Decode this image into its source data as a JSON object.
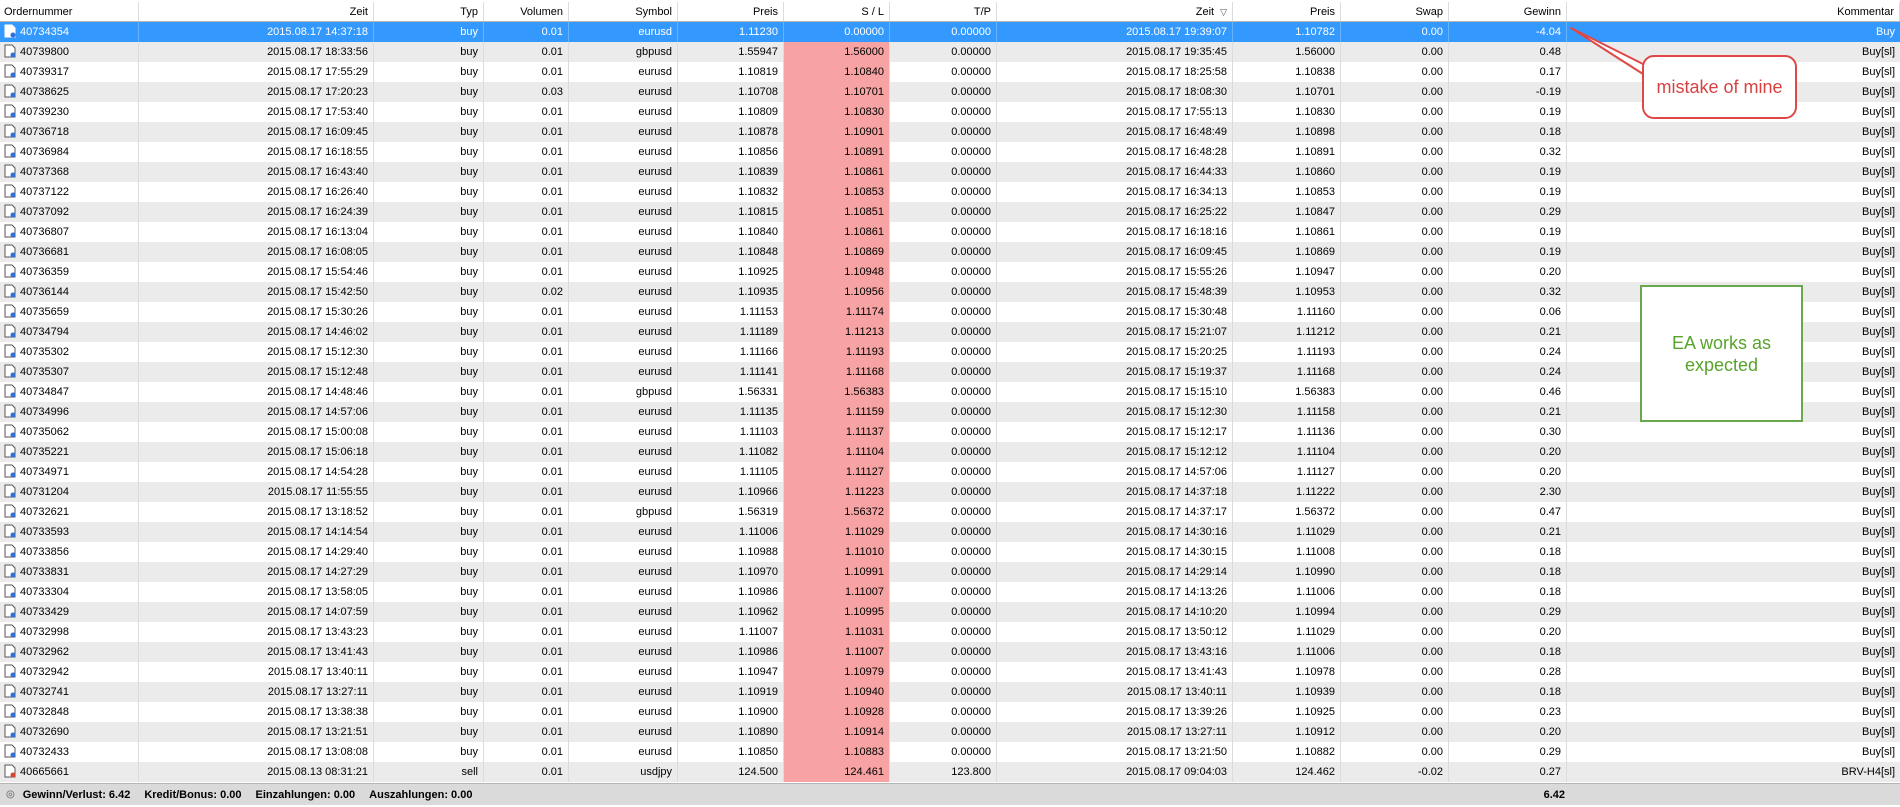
{
  "columns": {
    "order": "Ordernummer",
    "time": "Zeit",
    "type": "Typ",
    "volume": "Volumen",
    "symbol": "Symbol",
    "price": "Preis",
    "sl": "S / L",
    "tp": "T/P",
    "close_time": "Zeit",
    "close_price": "Preis",
    "swap": "Swap",
    "profit": "Gewinn",
    "comment": "Kommentar"
  },
  "rows": [
    {
      "order": "40734354",
      "time": "2015.08.17 14:37:18",
      "type": "buy",
      "volume": "0.01",
      "symbol": "eurusd",
      "price": "1.11230",
      "sl": "0.00000",
      "tp": "0.00000",
      "close_time": "2015.08.17 19:39:07",
      "close_price": "1.10782",
      "swap": "0.00",
      "profit": "-4.04",
      "comment": "Buy"
    },
    {
      "order": "40739800",
      "time": "2015.08.17 18:33:56",
      "type": "buy",
      "volume": "0.01",
      "symbol": "gbpusd",
      "price": "1.55947",
      "sl": "1.56000",
      "tp": "0.00000",
      "close_time": "2015.08.17 19:35:45",
      "close_price": "1.56000",
      "swap": "0.00",
      "profit": "0.48",
      "comment": "Buy[sl]"
    },
    {
      "order": "40739317",
      "time": "2015.08.17 17:55:29",
      "type": "buy",
      "volume": "0.01",
      "symbol": "eurusd",
      "price": "1.10819",
      "sl": "1.10840",
      "tp": "0.00000",
      "close_time": "2015.08.17 18:25:58",
      "close_price": "1.10838",
      "swap": "0.00",
      "profit": "0.17",
      "comment": "Buy[sl]"
    },
    {
      "order": "40738625",
      "time": "2015.08.17 17:20:23",
      "type": "buy",
      "volume": "0.03",
      "symbol": "eurusd",
      "price": "1.10708",
      "sl": "1.10701",
      "tp": "0.00000",
      "close_time": "2015.08.17 18:08:30",
      "close_price": "1.10701",
      "swap": "0.00",
      "profit": "-0.19",
      "comment": "Buy[sl]"
    },
    {
      "order": "40739230",
      "time": "2015.08.17 17:53:40",
      "type": "buy",
      "volume": "0.01",
      "symbol": "eurusd",
      "price": "1.10809",
      "sl": "1.10830",
      "tp": "0.00000",
      "close_time": "2015.08.17 17:55:13",
      "close_price": "1.10830",
      "swap": "0.00",
      "profit": "0.19",
      "comment": "Buy[sl]"
    },
    {
      "order": "40736718",
      "time": "2015.08.17 16:09:45",
      "type": "buy",
      "volume": "0.01",
      "symbol": "eurusd",
      "price": "1.10878",
      "sl": "1.10901",
      "tp": "0.00000",
      "close_time": "2015.08.17 16:48:49",
      "close_price": "1.10898",
      "swap": "0.00",
      "profit": "0.18",
      "comment": "Buy[sl]"
    },
    {
      "order": "40736984",
      "time": "2015.08.17 16:18:55",
      "type": "buy",
      "volume": "0.01",
      "symbol": "eurusd",
      "price": "1.10856",
      "sl": "1.10891",
      "tp": "0.00000",
      "close_time": "2015.08.17 16:48:28",
      "close_price": "1.10891",
      "swap": "0.00",
      "profit": "0.32",
      "comment": "Buy[sl]"
    },
    {
      "order": "40737368",
      "time": "2015.08.17 16:43:40",
      "type": "buy",
      "volume": "0.01",
      "symbol": "eurusd",
      "price": "1.10839",
      "sl": "1.10861",
      "tp": "0.00000",
      "close_time": "2015.08.17 16:44:33",
      "close_price": "1.10860",
      "swap": "0.00",
      "profit": "0.19",
      "comment": "Buy[sl]"
    },
    {
      "order": "40737122",
      "time": "2015.08.17 16:26:40",
      "type": "buy",
      "volume": "0.01",
      "symbol": "eurusd",
      "price": "1.10832",
      "sl": "1.10853",
      "tp": "0.00000",
      "close_time": "2015.08.17 16:34:13",
      "close_price": "1.10853",
      "swap": "0.00",
      "profit": "0.19",
      "comment": "Buy[sl]"
    },
    {
      "order": "40737092",
      "time": "2015.08.17 16:24:39",
      "type": "buy",
      "volume": "0.01",
      "symbol": "eurusd",
      "price": "1.10815",
      "sl": "1.10851",
      "tp": "0.00000",
      "close_time": "2015.08.17 16:25:22",
      "close_price": "1.10847",
      "swap": "0.00",
      "profit": "0.29",
      "comment": "Buy[sl]"
    },
    {
      "order": "40736807",
      "time": "2015.08.17 16:13:04",
      "type": "buy",
      "volume": "0.01",
      "symbol": "eurusd",
      "price": "1.10840",
      "sl": "1.10861",
      "tp": "0.00000",
      "close_time": "2015.08.17 16:18:16",
      "close_price": "1.10861",
      "swap": "0.00",
      "profit": "0.19",
      "comment": "Buy[sl]"
    },
    {
      "order": "40736681",
      "time": "2015.08.17 16:08:05",
      "type": "buy",
      "volume": "0.01",
      "symbol": "eurusd",
      "price": "1.10848",
      "sl": "1.10869",
      "tp": "0.00000",
      "close_time": "2015.08.17 16:09:45",
      "close_price": "1.10869",
      "swap": "0.00",
      "profit": "0.19",
      "comment": "Buy[sl]"
    },
    {
      "order": "40736359",
      "time": "2015.08.17 15:54:46",
      "type": "buy",
      "volume": "0.01",
      "symbol": "eurusd",
      "price": "1.10925",
      "sl": "1.10948",
      "tp": "0.00000",
      "close_time": "2015.08.17 15:55:26",
      "close_price": "1.10947",
      "swap": "0.00",
      "profit": "0.20",
      "comment": "Buy[sl]"
    },
    {
      "order": "40736144",
      "time": "2015.08.17 15:42:50",
      "type": "buy",
      "volume": "0.02",
      "symbol": "eurusd",
      "price": "1.10935",
      "sl": "1.10956",
      "tp": "0.00000",
      "close_time": "2015.08.17 15:48:39",
      "close_price": "1.10953",
      "swap": "0.00",
      "profit": "0.32",
      "comment": "Buy[sl]"
    },
    {
      "order": "40735659",
      "time": "2015.08.17 15:30:26",
      "type": "buy",
      "volume": "0.01",
      "symbol": "eurusd",
      "price": "1.11153",
      "sl": "1.11174",
      "tp": "0.00000",
      "close_time": "2015.08.17 15:30:48",
      "close_price": "1.11160",
      "swap": "0.00",
      "profit": "0.06",
      "comment": "Buy[sl]"
    },
    {
      "order": "40734794",
      "time": "2015.08.17 14:46:02",
      "type": "buy",
      "volume": "0.01",
      "symbol": "eurusd",
      "price": "1.11189",
      "sl": "1.11213",
      "tp": "0.00000",
      "close_time": "2015.08.17 15:21:07",
      "close_price": "1.11212",
      "swap": "0.00",
      "profit": "0.21",
      "comment": "Buy[sl]"
    },
    {
      "order": "40735302",
      "time": "2015.08.17 15:12:30",
      "type": "buy",
      "volume": "0.01",
      "symbol": "eurusd",
      "price": "1.11166",
      "sl": "1.11193",
      "tp": "0.00000",
      "close_time": "2015.08.17 15:20:25",
      "close_price": "1.11193",
      "swap": "0.00",
      "profit": "0.24",
      "comment": "Buy[sl]"
    },
    {
      "order": "40735307",
      "time": "2015.08.17 15:12:48",
      "type": "buy",
      "volume": "0.01",
      "symbol": "eurusd",
      "price": "1.11141",
      "sl": "1.11168",
      "tp": "0.00000",
      "close_time": "2015.08.17 15:19:37",
      "close_price": "1.11168",
      "swap": "0.00",
      "profit": "0.24",
      "comment": "Buy[sl]"
    },
    {
      "order": "40734847",
      "time": "2015.08.17 14:48:46",
      "type": "buy",
      "volume": "0.01",
      "symbol": "gbpusd",
      "price": "1.56331",
      "sl": "1.56383",
      "tp": "0.00000",
      "close_time": "2015.08.17 15:15:10",
      "close_price": "1.56383",
      "swap": "0.00",
      "profit": "0.46",
      "comment": "Buy[sl]"
    },
    {
      "order": "40734996",
      "time": "2015.08.17 14:57:06",
      "type": "buy",
      "volume": "0.01",
      "symbol": "eurusd",
      "price": "1.11135",
      "sl": "1.11159",
      "tp": "0.00000",
      "close_time": "2015.08.17 15:12:30",
      "close_price": "1.11158",
      "swap": "0.00",
      "profit": "0.21",
      "comment": "Buy[sl]"
    },
    {
      "order": "40735062",
      "time": "2015.08.17 15:00:08",
      "type": "buy",
      "volume": "0.01",
      "symbol": "eurusd",
      "price": "1.11103",
      "sl": "1.11137",
      "tp": "0.00000",
      "close_time": "2015.08.17 15:12:17",
      "close_price": "1.11136",
      "swap": "0.00",
      "profit": "0.30",
      "comment": "Buy[sl]"
    },
    {
      "order": "40735221",
      "time": "2015.08.17 15:06:18",
      "type": "buy",
      "volume": "0.01",
      "symbol": "eurusd",
      "price": "1.11082",
      "sl": "1.11104",
      "tp": "0.00000",
      "close_time": "2015.08.17 15:12:12",
      "close_price": "1.11104",
      "swap": "0.00",
      "profit": "0.20",
      "comment": "Buy[sl]"
    },
    {
      "order": "40734971",
      "time": "2015.08.17 14:54:28",
      "type": "buy",
      "volume": "0.01",
      "symbol": "eurusd",
      "price": "1.11105",
      "sl": "1.11127",
      "tp": "0.00000",
      "close_time": "2015.08.17 14:57:06",
      "close_price": "1.11127",
      "swap": "0.00",
      "profit": "0.20",
      "comment": "Buy[sl]"
    },
    {
      "order": "40731204",
      "time": "2015.08.17 11:55:55",
      "type": "buy",
      "volume": "0.01",
      "symbol": "eurusd",
      "price": "1.10966",
      "sl": "1.11223",
      "tp": "0.00000",
      "close_time": "2015.08.17 14:37:18",
      "close_price": "1.11222",
      "swap": "0.00",
      "profit": "2.30",
      "comment": "Buy[sl]"
    },
    {
      "order": "40732621",
      "time": "2015.08.17 13:18:52",
      "type": "buy",
      "volume": "0.01",
      "symbol": "gbpusd",
      "price": "1.56319",
      "sl": "1.56372",
      "tp": "0.00000",
      "close_time": "2015.08.17 14:37:17",
      "close_price": "1.56372",
      "swap": "0.00",
      "profit": "0.47",
      "comment": "Buy[sl]"
    },
    {
      "order": "40733593",
      "time": "2015.08.17 14:14:54",
      "type": "buy",
      "volume": "0.01",
      "symbol": "eurusd",
      "price": "1.11006",
      "sl": "1.11029",
      "tp": "0.00000",
      "close_time": "2015.08.17 14:30:16",
      "close_price": "1.11029",
      "swap": "0.00",
      "profit": "0.21",
      "comment": "Buy[sl]"
    },
    {
      "order": "40733856",
      "time": "2015.08.17 14:29:40",
      "type": "buy",
      "volume": "0.01",
      "symbol": "eurusd",
      "price": "1.10988",
      "sl": "1.11010",
      "tp": "0.00000",
      "close_time": "2015.08.17 14:30:15",
      "close_price": "1.11008",
      "swap": "0.00",
      "profit": "0.18",
      "comment": "Buy[sl]"
    },
    {
      "order": "40733831",
      "time": "2015.08.17 14:27:29",
      "type": "buy",
      "volume": "0.01",
      "symbol": "eurusd",
      "price": "1.10970",
      "sl": "1.10991",
      "tp": "0.00000",
      "close_time": "2015.08.17 14:29:14",
      "close_price": "1.10990",
      "swap": "0.00",
      "profit": "0.18",
      "comment": "Buy[sl]"
    },
    {
      "order": "40733304",
      "time": "2015.08.17 13:58:05",
      "type": "buy",
      "volume": "0.01",
      "symbol": "eurusd",
      "price": "1.10986",
      "sl": "1.11007",
      "tp": "0.00000",
      "close_time": "2015.08.17 14:13:26",
      "close_price": "1.11006",
      "swap": "0.00",
      "profit": "0.18",
      "comment": "Buy[sl]"
    },
    {
      "order": "40733429",
      "time": "2015.08.17 14:07:59",
      "type": "buy",
      "volume": "0.01",
      "symbol": "eurusd",
      "price": "1.10962",
      "sl": "1.10995",
      "tp": "0.00000",
      "close_time": "2015.08.17 14:10:20",
      "close_price": "1.10994",
      "swap": "0.00",
      "profit": "0.29",
      "comment": "Buy[sl]"
    },
    {
      "order": "40732998",
      "time": "2015.08.17 13:43:23",
      "type": "buy",
      "volume": "0.01",
      "symbol": "eurusd",
      "price": "1.11007",
      "sl": "1.11031",
      "tp": "0.00000",
      "close_time": "2015.08.17 13:50:12",
      "close_price": "1.11029",
      "swap": "0.00",
      "profit": "0.20",
      "comment": "Buy[sl]"
    },
    {
      "order": "40732962",
      "time": "2015.08.17 13:41:43",
      "type": "buy",
      "volume": "0.01",
      "symbol": "eurusd",
      "price": "1.10986",
      "sl": "1.11007",
      "tp": "0.00000",
      "close_time": "2015.08.17 13:43:16",
      "close_price": "1.11006",
      "swap": "0.00",
      "profit": "0.18",
      "comment": "Buy[sl]"
    },
    {
      "order": "40732942",
      "time": "2015.08.17 13:40:11",
      "type": "buy",
      "volume": "0.01",
      "symbol": "eurusd",
      "price": "1.10947",
      "sl": "1.10979",
      "tp": "0.00000",
      "close_time": "2015.08.17 13:41:43",
      "close_price": "1.10978",
      "swap": "0.00",
      "profit": "0.28",
      "comment": "Buy[sl]"
    },
    {
      "order": "40732741",
      "time": "2015.08.17 13:27:11",
      "type": "buy",
      "volume": "0.01",
      "symbol": "eurusd",
      "price": "1.10919",
      "sl": "1.10940",
      "tp": "0.00000",
      "close_time": "2015.08.17 13:40:11",
      "close_price": "1.10939",
      "swap": "0.00",
      "profit": "0.18",
      "comment": "Buy[sl]"
    },
    {
      "order": "40732848",
      "time": "2015.08.17 13:38:38",
      "type": "buy",
      "volume": "0.01",
      "symbol": "eurusd",
      "price": "1.10900",
      "sl": "1.10928",
      "tp": "0.00000",
      "close_time": "2015.08.17 13:39:26",
      "close_price": "1.10925",
      "swap": "0.00",
      "profit": "0.23",
      "comment": "Buy[sl]"
    },
    {
      "order": "40732690",
      "time": "2015.08.17 13:21:51",
      "type": "buy",
      "volume": "0.01",
      "symbol": "eurusd",
      "price": "1.10890",
      "sl": "1.10914",
      "tp": "0.00000",
      "close_time": "2015.08.17 13:27:11",
      "close_price": "1.10912",
      "swap": "0.00",
      "profit": "0.20",
      "comment": "Buy[sl]"
    },
    {
      "order": "40732433",
      "time": "2015.08.17 13:08:08",
      "type": "buy",
      "volume": "0.01",
      "symbol": "eurusd",
      "price": "1.10850",
      "sl": "1.10883",
      "tp": "0.00000",
      "close_time": "2015.08.17 13:21:50",
      "close_price": "1.10882",
      "swap": "0.00",
      "profit": "0.29",
      "comment": "Buy[sl]"
    },
    {
      "order": "40665661",
      "time": "2015.08.13 08:31:21",
      "type": "sell",
      "volume": "0.01",
      "symbol": "usdjpy",
      "price": "124.500",
      "sl": "124.461",
      "tp": "123.800",
      "close_time": "2015.08.17 09:04:03",
      "close_price": "124.462",
      "swap": "-0.02",
      "profit": "0.27",
      "comment": "BRV-H4[sl]"
    }
  ],
  "footer": {
    "pnl": "Gewinn/Verlust: 6.42",
    "credit": "Kredit/Bonus: 0.00",
    "deposits": "Einzahlungen: 0.00",
    "withdrawals": "Auszahlungen: 0.00",
    "total": "6.42"
  },
  "annotations": {
    "mistake": "mistake of mine",
    "ea": "EA works as expected"
  },
  "colors": {
    "selected_row": "#3399ff",
    "sl_highlight": "#f7a3a3",
    "stripe": "#ebebeb",
    "callout_red": "#e04848",
    "callout_green": "#6aa84f"
  }
}
